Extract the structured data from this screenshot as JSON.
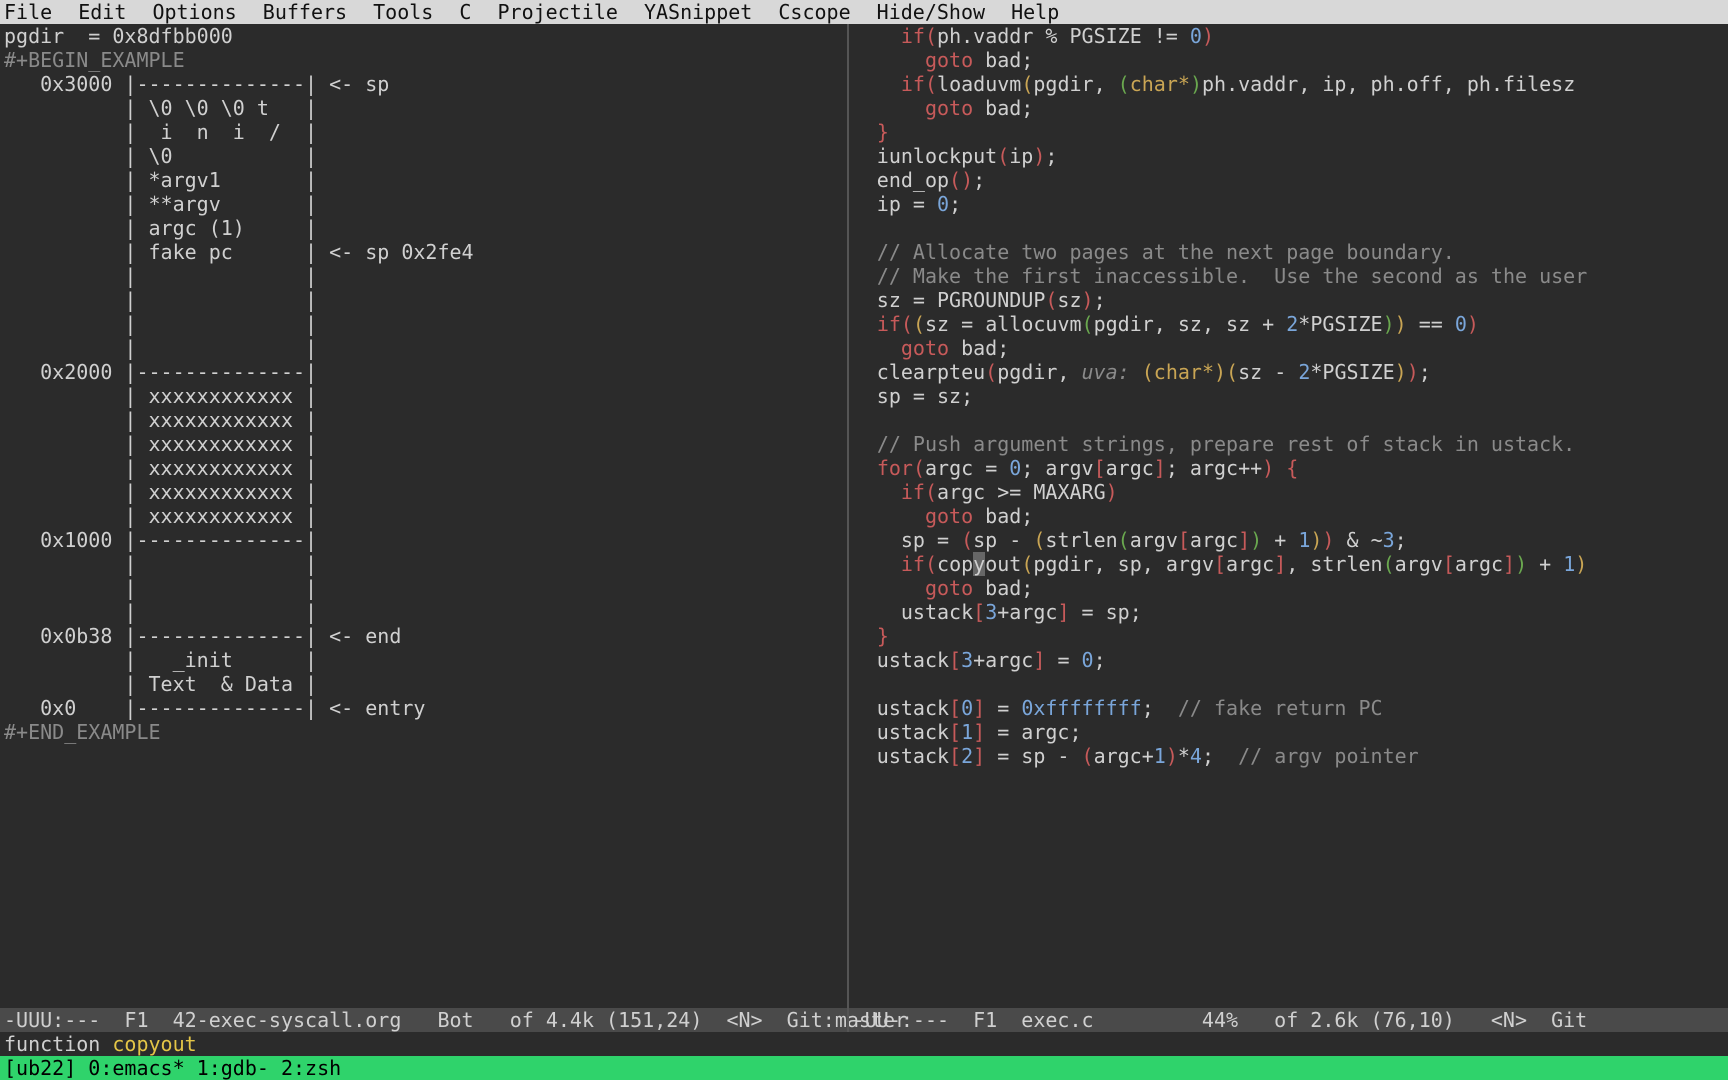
{
  "menubar": {
    "items": [
      "File",
      "Edit",
      "Options",
      "Buffers",
      "Tools",
      "C",
      "Projectile",
      "YASnippet",
      "Cscope",
      "Hide/Show",
      "Help"
    ]
  },
  "left": {
    "lines": [
      {
        "t": "pgdir  = 0x8dfbb000",
        "cls": ""
      },
      {
        "t": "#+BEGIN_EXAMPLE",
        "cls": "ex"
      },
      {
        "t": "   0x3000 |--------------| <- sp",
        "cls": ""
      },
      {
        "t": "          | \\0 \\0 \\0 t   |",
        "cls": ""
      },
      {
        "t": "          |  i  n  i  /  |",
        "cls": ""
      },
      {
        "t": "          | \\0           |",
        "cls": ""
      },
      {
        "t": "          | *argv1       |",
        "cls": ""
      },
      {
        "t": "          | **argv       |",
        "cls": ""
      },
      {
        "t": "          | argc (1)     |",
        "cls": ""
      },
      {
        "t": "          | fake pc      | <- sp 0x2fe4",
        "cls": ""
      },
      {
        "t": "          |              |",
        "cls": ""
      },
      {
        "t": "          |              |",
        "cls": ""
      },
      {
        "t": "          |              |",
        "cls": ""
      },
      {
        "t": "          |              |",
        "cls": ""
      },
      {
        "t": "   0x2000 |--------------|",
        "cls": ""
      },
      {
        "t": "          | xxxxxxxxxxxx |",
        "cls": ""
      },
      {
        "t": "          | xxxxxxxxxxxx |",
        "cls": ""
      },
      {
        "t": "          | xxxxxxxxxxxx |",
        "cls": ""
      },
      {
        "t": "          | xxxxxxxxxxxx |",
        "cls": ""
      },
      {
        "t": "          | xxxxxxxxxxxx |",
        "cls": ""
      },
      {
        "t": "          | xxxxxxxxxxxx |",
        "cls": ""
      },
      {
        "t": "   0x1000 |--------------|",
        "cls": ""
      },
      {
        "t": "          |              |",
        "cls": ""
      },
      {
        "t": "          |              |",
        "cls": ""
      },
      {
        "t": "          |              |",
        "cls": ""
      },
      {
        "t": "   0x0b38 |--------------| <- end",
        "cls": ""
      },
      {
        "t": "          |   _init      |",
        "cls": ""
      },
      {
        "t": "          | Text  & Data |",
        "cls": ""
      },
      {
        "t": "   0x0    |--------------| <- entry",
        "cls": ""
      },
      {
        "t": "#+END_EXAMPLE",
        "cls": "ex"
      }
    ]
  },
  "right": {
    "lines": [
      "    if(ph.vaddr % PGSIZE != 0)",
      "      goto bad;",
      "    if(loaduvm(pgdir, (char*)ph.vaddr, ip, ph.off, ph.filesz",
      "      goto bad;",
      "  }",
      "  iunlockput(ip);",
      "  end_op();",
      "  ip = 0;",
      "",
      "  // Allocate two pages at the next page boundary.",
      "  // Make the first inaccessible.  Use the second as the user",
      "  sz = PGROUNDUP(sz);",
      "  if((sz = allocuvm(pgdir, sz, sz + 2*PGSIZE)) == 0)",
      "    goto bad;",
      "  clearpteu(pgdir, uva: (char*)(sz - 2*PGSIZE));",
      "  sp = sz;",
      "",
      "  // Push argument strings, prepare rest of stack in ustack.",
      "  for(argc = 0; argv[argc]; argc++) {",
      "    if(argc >= MAXARG)",
      "      goto bad;",
      "    sp = (sp - (strlen(argv[argc]) + 1)) & ~3;",
      "    if(copyout(pgdir, sp, argv[argc], strlen(argv[argc]) + 1)",
      "      goto bad;",
      "    ustack[3+argc] = sp;",
      "  }",
      "  ustack[3+argc] = 0;",
      "",
      "  ustack[0] = 0xffffffff;  // fake return PC",
      "  ustack[1] = argc;",
      "  ustack[2] = sp - (argc+1)*4;  // argv pointer"
    ]
  },
  "modeline": {
    "left": "-UUU:---  F1  42-exec-syscall.org   Bot   of 4.4k (151,24)  <N>  Git:master",
    "right": "-UU-:---  F1  exec.c         44%   of 2.6k (76,10)   <N>  Git"
  },
  "minibuffer": {
    "prefix": "function ",
    "highlight": "copyout"
  },
  "tmux": {
    "text": "[ub22] 0:emacs* 1:gdb- 2:zsh"
  }
}
